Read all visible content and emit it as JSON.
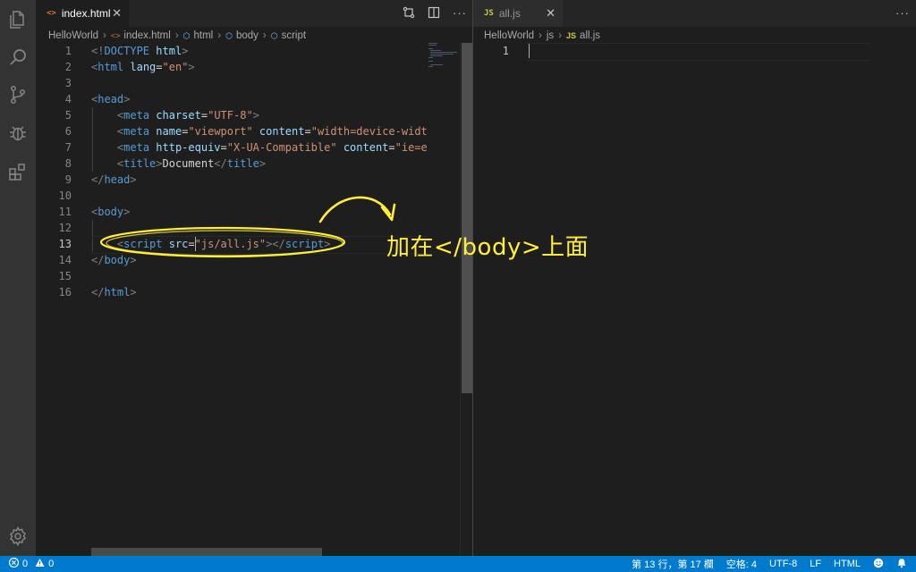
{
  "left_editor": {
    "tab": {
      "icon": "<>",
      "label": "index.html"
    },
    "breadcrumb": {
      "folder": "HelloWorld",
      "file": "index.html",
      "sym1": "html",
      "sym2": "body",
      "sym3": "script"
    },
    "lines": [
      {
        "n": "1",
        "parts": [
          [
            "c-punc",
            "<!"
          ],
          [
            "c-tag",
            "DOCTYPE"
          ],
          [
            "c-text",
            " "
          ],
          [
            "c-attr",
            "html"
          ],
          [
            "c-punc",
            ">"
          ]
        ]
      },
      {
        "n": "2",
        "parts": [
          [
            "c-punc",
            "<"
          ],
          [
            "c-tag",
            "html"
          ],
          [
            "c-text",
            " "
          ],
          [
            "c-attr",
            "lang"
          ],
          [
            "c-text",
            "="
          ],
          [
            "c-str",
            "\"en\""
          ],
          [
            "c-punc",
            ">"
          ]
        ]
      },
      {
        "n": "3",
        "parts": []
      },
      {
        "n": "4",
        "parts": [
          [
            "c-punc",
            "<"
          ],
          [
            "c-tag",
            "head"
          ],
          [
            "c-punc",
            ">"
          ]
        ]
      },
      {
        "n": "5",
        "parts": [
          [
            "c-text",
            "    "
          ],
          [
            "c-punc",
            "<"
          ],
          [
            "c-tag",
            "meta"
          ],
          [
            "c-text",
            " "
          ],
          [
            "c-attr",
            "charset"
          ],
          [
            "c-text",
            "="
          ],
          [
            "c-str",
            "\"UTF-8\""
          ],
          [
            "c-punc",
            ">"
          ]
        ]
      },
      {
        "n": "6",
        "parts": [
          [
            "c-text",
            "    "
          ],
          [
            "c-punc",
            "<"
          ],
          [
            "c-tag",
            "meta"
          ],
          [
            "c-text",
            " "
          ],
          [
            "c-attr",
            "name"
          ],
          [
            "c-text",
            "="
          ],
          [
            "c-str",
            "\"viewport\""
          ],
          [
            "c-text",
            " "
          ],
          [
            "c-attr",
            "content"
          ],
          [
            "c-text",
            "="
          ],
          [
            "c-str",
            "\"width=device-width"
          ]
        ]
      },
      {
        "n": "7",
        "parts": [
          [
            "c-text",
            "    "
          ],
          [
            "c-punc",
            "<"
          ],
          [
            "c-tag",
            "meta"
          ],
          [
            "c-text",
            " "
          ],
          [
            "c-attr",
            "http-equiv"
          ],
          [
            "c-text",
            "="
          ],
          [
            "c-str",
            "\"X-UA-Compatible\""
          ],
          [
            "c-text",
            " "
          ],
          [
            "c-attr",
            "content"
          ],
          [
            "c-text",
            "="
          ],
          [
            "c-str",
            "\"ie=ed"
          ]
        ]
      },
      {
        "n": "8",
        "parts": [
          [
            "c-text",
            "    "
          ],
          [
            "c-punc",
            "<"
          ],
          [
            "c-tag",
            "title"
          ],
          [
            "c-punc",
            ">"
          ],
          [
            "c-text",
            "Document"
          ],
          [
            "c-punc",
            "</"
          ],
          [
            "c-tag",
            "title"
          ],
          [
            "c-punc",
            ">"
          ]
        ]
      },
      {
        "n": "9",
        "parts": [
          [
            "c-punc",
            "</"
          ],
          [
            "c-tag",
            "head"
          ],
          [
            "c-punc",
            ">"
          ]
        ]
      },
      {
        "n": "10",
        "parts": []
      },
      {
        "n": "11",
        "parts": [
          [
            "c-punc",
            "<"
          ],
          [
            "c-tag",
            "body"
          ],
          [
            "c-punc",
            ">"
          ]
        ]
      },
      {
        "n": "12",
        "parts": []
      },
      {
        "n": "13",
        "parts": [
          [
            "c-text",
            "    "
          ],
          [
            "c-punc",
            "<"
          ],
          [
            "c-tag",
            "script"
          ],
          [
            "c-text",
            " "
          ],
          [
            "c-attr",
            "src"
          ],
          [
            "c-text",
            "="
          ],
          [
            "c-str",
            "\"js/all.js\""
          ],
          [
            "c-punc",
            "></"
          ],
          [
            "c-tag",
            "script"
          ],
          [
            "c-punc",
            ">"
          ]
        ]
      },
      {
        "n": "14",
        "parts": [
          [
            "c-punc",
            "</"
          ],
          [
            "c-tag",
            "body"
          ],
          [
            "c-punc",
            ">"
          ]
        ]
      },
      {
        "n": "15",
        "parts": []
      },
      {
        "n": "16",
        "parts": [
          [
            "c-punc",
            "</"
          ],
          [
            "c-tag",
            "html"
          ],
          [
            "c-punc",
            ">"
          ]
        ]
      }
    ]
  },
  "right_editor": {
    "tab": {
      "icon": "JS",
      "label": "all.js"
    },
    "breadcrumb": {
      "folder": "HelloWorld",
      "sub": "js",
      "icon": "JS",
      "file": "all.js"
    },
    "lines": [
      {
        "n": "1",
        "parts": []
      }
    ]
  },
  "annotation": {
    "text": "加在</body>上面"
  },
  "status": {
    "errors": "0",
    "warnings": "0",
    "position": "第 13 行，第 17 欄",
    "spaces": "空格: 4",
    "encoding": "UTF-8",
    "eol": "LF",
    "language": "HTML"
  },
  "colors": {
    "accent": "#007acc",
    "annotation": "#ffef3a",
    "html_icon": "#e37933",
    "js_icon": "#cbcb41"
  },
  "icons": {
    "activity": [
      "files-icon",
      "search-icon",
      "source-control-icon",
      "debug-icon",
      "extensions-icon",
      "settings-gear-icon"
    ],
    "toolbar": [
      "open-changes-icon",
      "split-editor-icon",
      "more-actions-icon"
    ],
    "status": [
      "error-icon",
      "warning-icon",
      "feedback-smiley-icon",
      "notifications-bell-icon"
    ]
  }
}
